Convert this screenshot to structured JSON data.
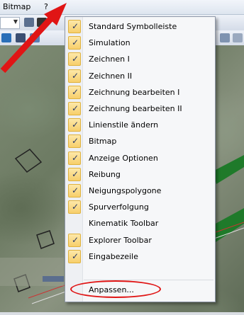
{
  "menubar": {
    "items": [
      "Bitmap",
      "?"
    ]
  },
  "menu": {
    "items": [
      {
        "label": "Standard Symbolleiste",
        "checked": true
      },
      {
        "label": "Simulation",
        "checked": true
      },
      {
        "label": "Zeichnen I",
        "checked": true
      },
      {
        "label": "Zeichnen II",
        "checked": true
      },
      {
        "label": "Zeichnung bearbeiten I",
        "checked": true
      },
      {
        "label": "Zeichnung bearbeiten II",
        "checked": true
      },
      {
        "label": "Linienstile ändern",
        "checked": true
      },
      {
        "label": "Bitmap",
        "checked": true
      },
      {
        "label": "Anzeige Optionen",
        "checked": true
      },
      {
        "label": "Reibung",
        "checked": true
      },
      {
        "label": "Neigungspolygone",
        "checked": true
      },
      {
        "label": "Spurverfolgung",
        "checked": true
      },
      {
        "label": "Kinematik Toolbar",
        "checked": false
      },
      {
        "label": "Explorer Toolbar",
        "checked": true
      },
      {
        "label": "Eingabezeile",
        "checked": true
      }
    ],
    "customize_label": "Anpassen..."
  },
  "colors": {
    "highlight_red": "#e01515",
    "check_bg": "#f7cf6b"
  }
}
